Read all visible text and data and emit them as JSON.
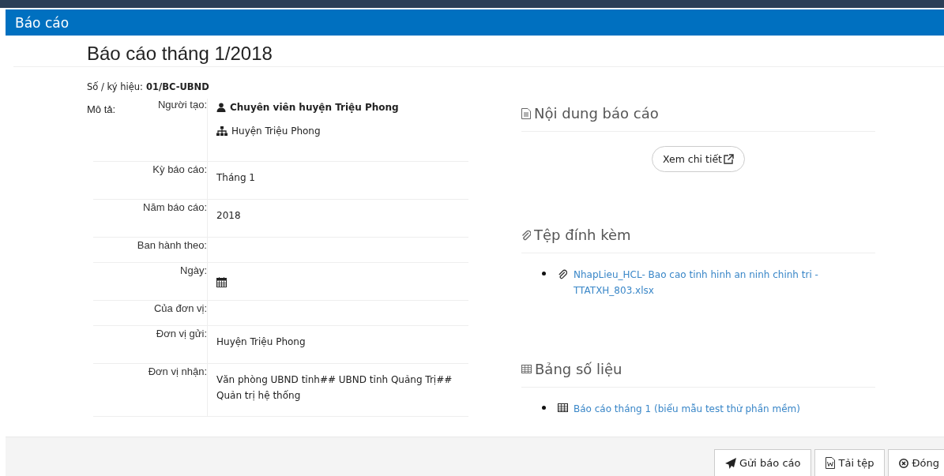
{
  "header": {
    "title": "Báo cáo"
  },
  "report": {
    "title": "Báo cáo tháng 1/2018",
    "code_label": "Số / ký hiệu:",
    "code": "01/BC-UBND",
    "description_label": "Mô tả:",
    "fields": [
      {
        "kind": "creator",
        "label": "Người tạo:",
        "person": "Chuyên viên huyện Triệu Phong",
        "unit": "Huyện Triệu Phong"
      },
      {
        "kind": "text",
        "label": "Kỳ báo cáo:",
        "value": "Tháng 1"
      },
      {
        "kind": "text",
        "label": "Năm báo cáo:",
        "value": "2018"
      },
      {
        "kind": "text",
        "label": "Ban hành theo:"
      },
      {
        "kind": "date",
        "label": "Ngày:"
      },
      {
        "kind": "text",
        "label": "Của đơn vị:"
      },
      {
        "kind": "text",
        "label": "Đơn vị gửi:",
        "value": "Huyện Triệu Phong"
      },
      {
        "kind": "text",
        "label": "Đơn vị nhận:",
        "value": "Văn phòng UBND tỉnh## UBND tỉnh Quảng Trị## Quản trị hệ thống"
      }
    ]
  },
  "content": {
    "title": "Nội dung báo cáo",
    "button": "Xem chi tiết"
  },
  "attachments": {
    "title": "Tệp đính kèm",
    "files": [
      "NhapLieu_HCL- Bao cao tinh hinh an ninh chinh tri - TTATXH_803.xlsx"
    ]
  },
  "data_tables": {
    "title": "Bảng số liệu",
    "items": [
      "Báo cáo tháng 1 (biểu mẫu test thử phần mềm)"
    ]
  },
  "footer": {
    "buttons": [
      {
        "kind": "send",
        "label": "Gửi báo cáo"
      },
      {
        "kind": "download",
        "label": "Tải tệp"
      },
      {
        "kind": "close",
        "label": "Đóng"
      }
    ]
  }
}
